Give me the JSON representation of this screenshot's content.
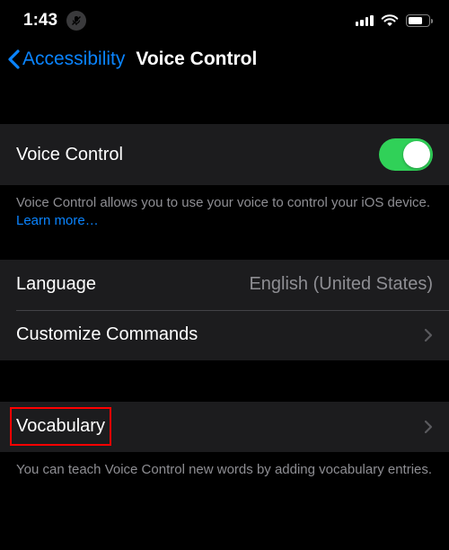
{
  "statusBar": {
    "time": "1:43"
  },
  "nav": {
    "backLabel": "Accessibility",
    "title": "Voice Control"
  },
  "group1": {
    "voiceControlLabel": "Voice Control",
    "toggleOn": true,
    "footer": "Voice Control allows you to use your voice to control your iOS device. ",
    "learnMore": "Learn more…"
  },
  "group2": {
    "languageLabel": "Language",
    "languageValue": "English (United States)",
    "customizeLabel": "Customize Commands"
  },
  "group3": {
    "vocabularyLabel": "Vocabulary",
    "footer": "You can teach Voice Control new words by adding vocabulary entries."
  }
}
